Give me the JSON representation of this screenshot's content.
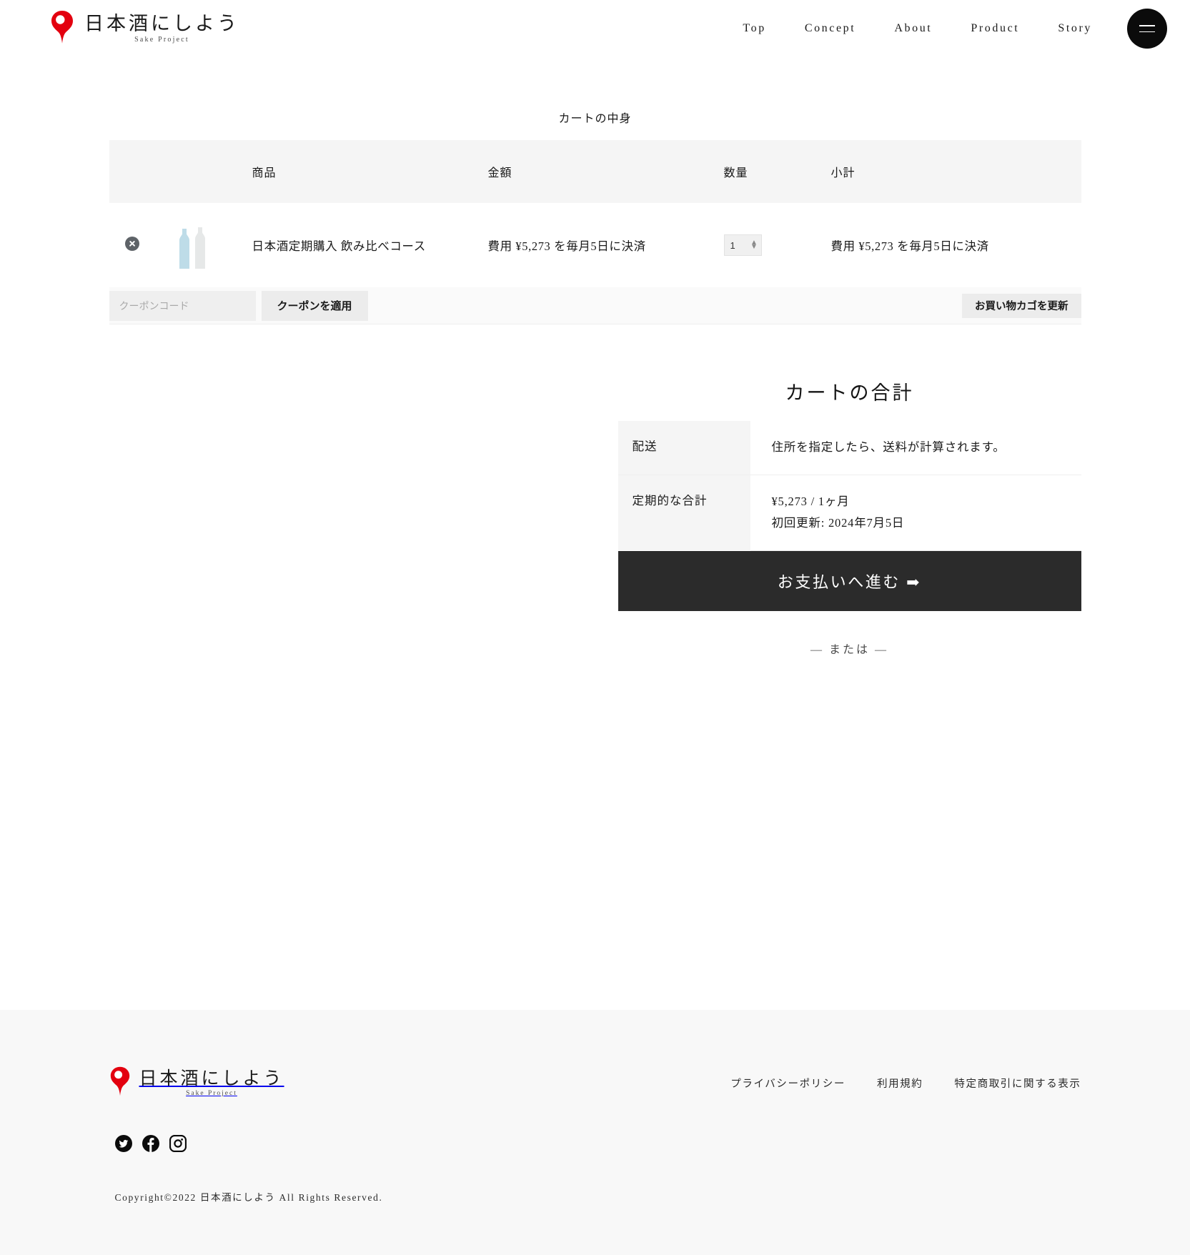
{
  "brand": {
    "name": "日本酒にしよう",
    "subtitle": "Sake Project",
    "logo_icon": "sake-pin-icon"
  },
  "header": {
    "nav": [
      {
        "label": "Top"
      },
      {
        "label": "Concept"
      },
      {
        "label": "About"
      },
      {
        "label": "Product"
      },
      {
        "label": "Story"
      }
    ],
    "menu_toggle_icon": "hamburger-menu-icon"
  },
  "cart": {
    "heading": "カートの中身",
    "columns": {
      "remove": "",
      "thumb": "",
      "product": "商品",
      "price": "金額",
      "quantity": "数量",
      "subtotal": "小計"
    },
    "items": [
      {
        "remove_icon": "remove-item-icon",
        "thumb_icon": "sake-bottles-thumbnail",
        "name": "日本酒定期購入 飲み比べコース",
        "price": "費用 ¥5,273 を毎月5日に決済",
        "quantity": "1",
        "subtotal": "費用 ¥5,273 を毎月5日に決済"
      }
    ],
    "coupon": {
      "placeholder": "クーポンコード",
      "value": "",
      "apply_label": "クーポンを適用"
    },
    "update_label": "お買い物カゴを更新"
  },
  "totals": {
    "title": "カートの合計",
    "shipping_label": "配送",
    "shipping_value": "住所を指定したら、送料が計算されます。",
    "recurring_label": "定期的な合計",
    "recurring_amount": "¥5,273 / 1ヶ月",
    "first_renewal": "初回更新: 2024年7月5日",
    "checkout_label": "お支払いへ進む ➡",
    "or_text": "— または —"
  },
  "footer": {
    "links": [
      {
        "label": "プライバシーポリシー"
      },
      {
        "label": "利用規約"
      },
      {
        "label": "特定商取引に関する表示"
      }
    ],
    "socials": [
      {
        "icon": "twitter-icon"
      },
      {
        "icon": "facebook-icon"
      },
      {
        "icon": "instagram-icon"
      }
    ],
    "copyright": "Copyright©2022 日本酒にしよう All Rights Reserved."
  },
  "colors": {
    "brand_red": "#e3000f",
    "checkout_bg": "#2b2b2b",
    "header_band": "#f5f5f5",
    "footer_bg": "#f8f8f8",
    "bottle_blue": "#bedce8",
    "bottle_gray": "#e6e8e8"
  }
}
